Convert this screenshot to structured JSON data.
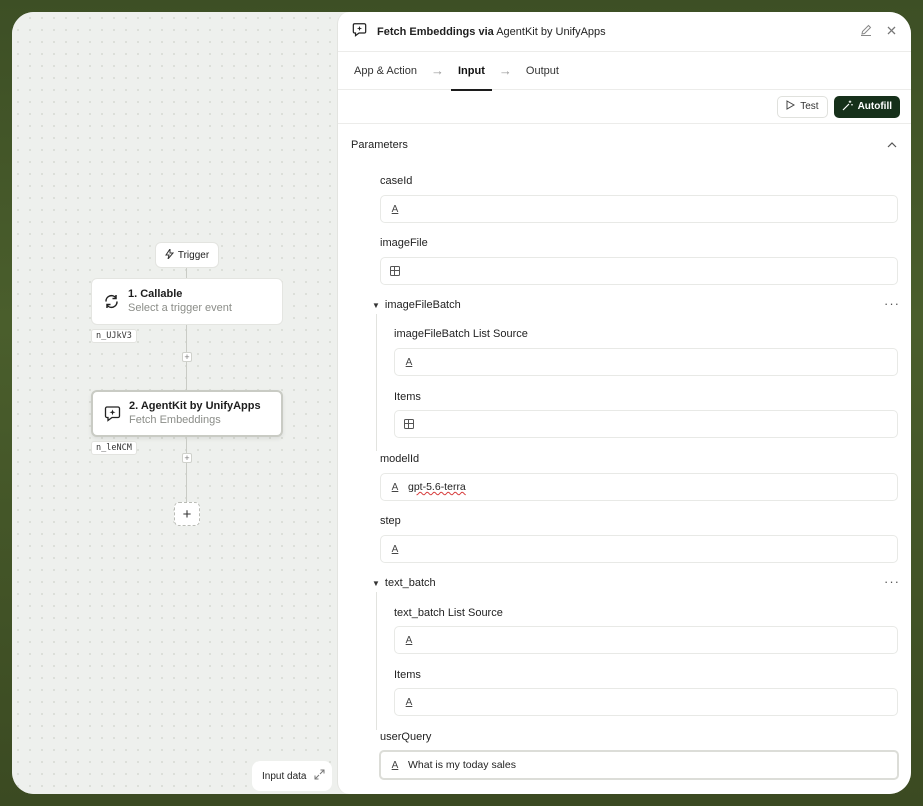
{
  "canvas": {
    "trigger_label": "Trigger",
    "nodes": [
      {
        "title": "1. Callable",
        "subtitle": "Select a trigger event",
        "id": "n_UJkV3"
      },
      {
        "title": "2. AgentKit by UnifyApps",
        "subtitle": "Fetch Embeddings",
        "id": "n_leNCM"
      }
    ],
    "input_data_label": "Input data"
  },
  "panel": {
    "title_action": "Fetch Embeddings via",
    "title_app": "AgentKit by UnifyApps",
    "tabs": [
      {
        "label": "App & Action"
      },
      {
        "label": "Input"
      },
      {
        "label": "Output"
      }
    ],
    "active_tab": "Input",
    "test_label": "Test",
    "autofill_label": "Autofill",
    "section_title": "Parameters",
    "fields": {
      "caseId": {
        "label": "caseId",
        "value": "",
        "type": "text"
      },
      "imageFile": {
        "label": "imageFile",
        "value": "",
        "type": "table"
      },
      "imageFileBatch": {
        "label": "imageFileBatch",
        "list_source_label": "imageFileBatch List Source",
        "list_source_value": "",
        "items_label": "Items"
      },
      "modelId": {
        "label": "modelId",
        "value": "gpt-5.6-terra"
      },
      "step": {
        "label": "step",
        "value": ""
      },
      "text_batch": {
        "label": "text_batch",
        "list_source_label": "text_batch List Source",
        "list_source_value": "",
        "items_label": "Items"
      },
      "userQuery": {
        "label": "userQuery",
        "value": "What is my today sales"
      }
    }
  },
  "colors": {
    "accent_dark_green": "#16301a",
    "background_gradient": "#3d4f25",
    "canvas_bg": "#eef0ed"
  }
}
